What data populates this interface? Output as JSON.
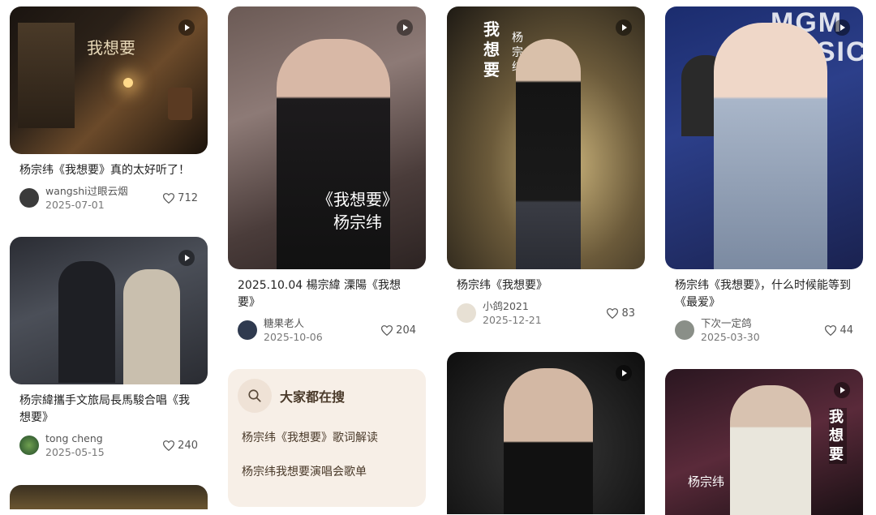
{
  "cards": [
    {
      "title": "杨宗纬《我想要》真的太好听了！",
      "author": "wangshi过眼云烟",
      "date": "2025-07-01",
      "likes": "712",
      "overlay": "我想要"
    },
    {
      "title": "杨宗緯攜手文旅局長馬駿合唱《我想要》",
      "author": "tong cheng",
      "date": "2025-05-15",
      "likes": "240"
    },
    {
      "title": "2025.10.04 楊宗緯 溧陽《我想要》",
      "author": "糖果老人",
      "date": "2025-10-06",
      "likes": "204",
      "overlay": [
        "《我想要》",
        "杨宗纬"
      ]
    },
    {
      "title": "杨宗纬《我想要》",
      "author": "小鸽2021",
      "date": "2025-12-21",
      "likes": "83",
      "overlay": [
        "我想要",
        "杨宗纬"
      ]
    },
    {
      "title": "杨宗纬《我想要》，什么时候能等到《最爱》",
      "author": "下次一定鸽",
      "date": "2025-03-30",
      "likes": "44",
      "overlay": "MGM MUSIC"
    },
    {
      "overlay": [
        "杨宗纬",
        "我想要"
      ]
    }
  ],
  "search": {
    "title": "大家都在搜",
    "items": [
      "杨宗纬《我想要》歌词解读",
      "杨宗纬我想要演唱会歌单"
    ]
  },
  "colors": {
    "accent_bg": "#f7efe7",
    "text": "#222222"
  }
}
